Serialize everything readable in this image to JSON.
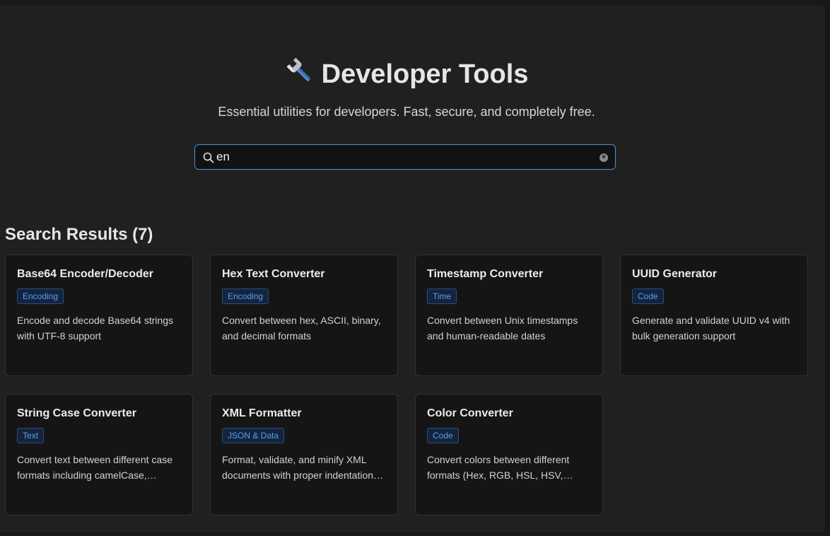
{
  "header": {
    "title": "Developer Tools",
    "subtitle": "Essential utilities for developers. Fast, secure, and completely free."
  },
  "search": {
    "value": "en"
  },
  "results": {
    "heading": "Search Results (7)"
  },
  "cards": [
    {
      "title": "Base64 Encoder/Decoder",
      "category": "Encoding",
      "description": "Encode and decode Base64 strings with UTF-8 support"
    },
    {
      "title": "Hex Text Converter",
      "category": "Encoding",
      "description": "Convert between hex, ASCII, binary, and decimal formats"
    },
    {
      "title": "Timestamp Converter",
      "category": "Time",
      "description": "Convert between Unix timestamps and human-readable dates"
    },
    {
      "title": "UUID Generator",
      "category": "Code",
      "description": "Generate and validate UUID v4 with bulk generation support"
    },
    {
      "title": "String Case Converter",
      "category": "Text",
      "description": "Convert text between different case formats including camelCase, snake_case, kebab-case and more"
    },
    {
      "title": "XML Formatter",
      "category": "JSON & Data",
      "description": "Format, validate, and minify XML documents with proper indentation and syntax checking"
    },
    {
      "title": "Color Converter",
      "category": "Code",
      "description": "Convert colors between different formats (Hex, RGB, HSL, HSV, CMYK) with live preview"
    }
  ],
  "colors": {
    "background": "#202020",
    "card": "#151515",
    "accent": "#4a90e2",
    "badge_text": "#5b9ef0"
  },
  "icons": {
    "title_icon": "wrench-icon",
    "search_icon": "search-icon",
    "clear_icon": "clear-icon"
  }
}
